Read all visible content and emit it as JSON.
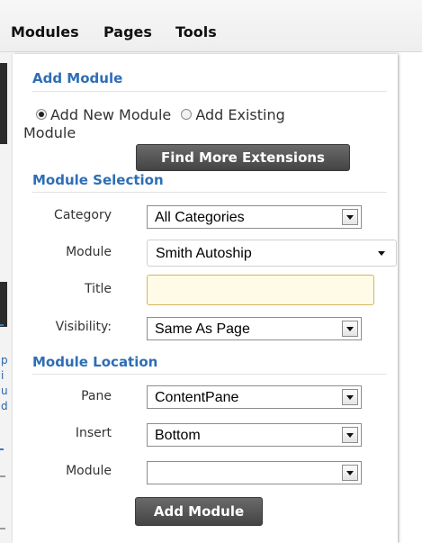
{
  "menu": {
    "items": [
      "Modules",
      "Pages",
      "Tools"
    ]
  },
  "add_module": {
    "heading": "Add Module",
    "radio_new": "Add New Module",
    "radio_existing": "Add Existing",
    "radio_existing_wrap": "Module",
    "find_more_button": "Find More Extensions"
  },
  "module_selection": {
    "heading": "Module Selection",
    "category_label": "Category",
    "category_value": "All Categories",
    "module_label": "Module",
    "module_value": "Smith Autoship",
    "title_label": "Title",
    "title_value": "",
    "visibility_label": "Visibility:",
    "visibility_value": "Same As Page"
  },
  "module_location": {
    "heading": "Module Location",
    "pane_label": "Pane",
    "pane_value": "ContentPane",
    "insert_label": "Insert",
    "insert_value": "Bottom",
    "module_label": "Module",
    "module_value": ""
  },
  "add_module_button": "Add Module",
  "left_strip_chars": [
    "p",
    "i",
    "u",
    "d"
  ]
}
